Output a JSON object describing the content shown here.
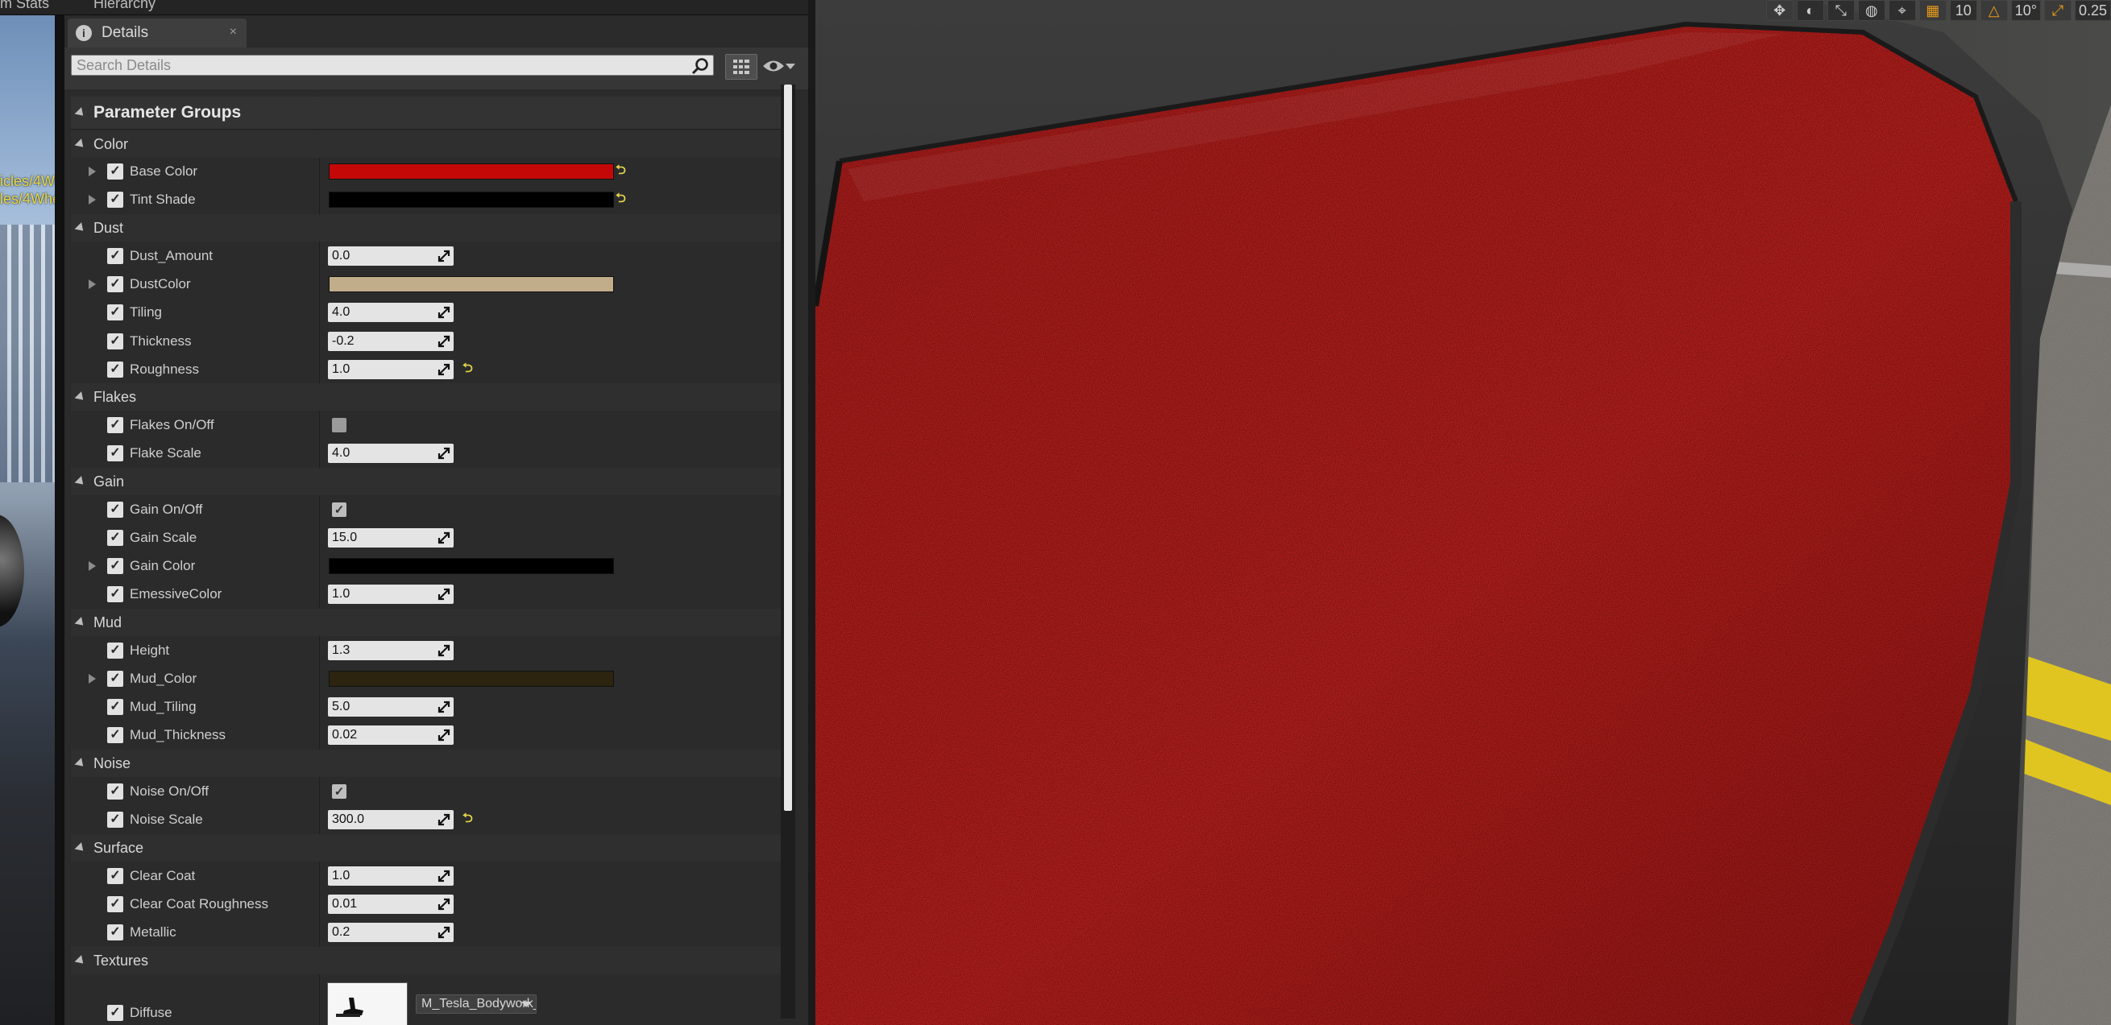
{
  "top_tabs": {
    "left_partial": "m Stats",
    "right_partial": "Hierarchy"
  },
  "left_view": {
    "path_line_1": "icles/4Wh",
    "path_line_2": "les/4Whe"
  },
  "panel": {
    "tab_title": "Details",
    "search_placeholder": "Search Details",
    "header": "Parameter Groups"
  },
  "groups": {
    "color": {
      "label": "Color",
      "base_color": {
        "label": "Base Color",
        "color": "#c40808"
      },
      "tint_shade": {
        "label": "Tint Shade",
        "color": "#000000"
      }
    },
    "dust": {
      "label": "Dust",
      "dust_amount": {
        "label": "Dust_Amount",
        "value": "0.0"
      },
      "dust_color": {
        "label": "DustColor",
        "color": "#c2ad8a"
      },
      "tiling": {
        "label": "Tiling",
        "value": "4.0"
      },
      "thickness": {
        "label": "Thickness",
        "value": "-0.2"
      },
      "roughness": {
        "label": "Roughness",
        "value": "1.0"
      }
    },
    "flakes": {
      "label": "Flakes",
      "flakes_onoff": {
        "label": "Flakes On/Off",
        "checked": false
      },
      "flake_scale": {
        "label": "Flake Scale",
        "value": "4.0"
      }
    },
    "gain": {
      "label": "Gain",
      "gain_onoff": {
        "label": "Gain On/Off",
        "checked": true
      },
      "gain_scale": {
        "label": "Gain Scale",
        "value": "15.0"
      },
      "gain_color": {
        "label": "Gain Color",
        "color": "#000000"
      },
      "emissive_color": {
        "label": "EmessiveColor",
        "value": "1.0"
      }
    },
    "mud": {
      "label": "Mud",
      "height": {
        "label": "Height",
        "value": "1.3"
      },
      "mud_color": {
        "label": "Mud_Color",
        "color": "#2c240f"
      },
      "mud_tiling": {
        "label": "Mud_Tiling",
        "value": "5.0"
      },
      "mud_thickness": {
        "label": "Mud_Thickness",
        "value": "0.02"
      }
    },
    "noise": {
      "label": "Noise",
      "noise_onoff": {
        "label": "Noise On/Off",
        "checked": true
      },
      "noise_scale": {
        "label": "Noise Scale",
        "value": "300.0"
      }
    },
    "surface": {
      "label": "Surface",
      "clear_coat": {
        "label": "Clear Coat",
        "value": "1.0"
      },
      "clear_coat_roughness": {
        "label": "Clear Coat Roughness",
        "value": "0.01"
      },
      "metallic": {
        "label": "Metallic",
        "value": "0.2"
      }
    },
    "textures": {
      "label": "Textures",
      "diffuse": {
        "label": "Diffuse",
        "asset": "M_Tesla_Bodywork_d_a"
      }
    }
  },
  "viewport_toolbar": {
    "grid_snap": "10",
    "angle_snap": "10°",
    "scale_snap": "0.25"
  },
  "colors": {
    "paint_red": "#b3201d",
    "reset_arrow": "#e3d34b",
    "road_yellow": "#e0c520"
  },
  "icons": [
    "search-icon",
    "grid-view-icon",
    "eye-icon",
    "reset-to-default-icon",
    "numeric-drag-icon",
    "dropdown-arrow-icon",
    "details-tab-icon"
  ]
}
